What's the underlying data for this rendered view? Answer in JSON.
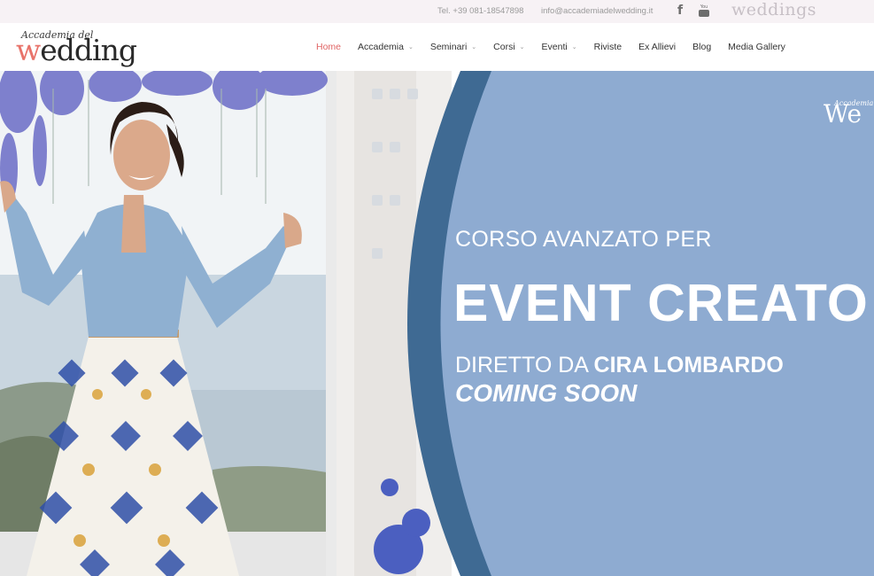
{
  "topbar": {
    "phone": "Tel. +39 081-18547898",
    "email": "info@accademiadelwedding.it",
    "facebook_icon": "facebook-icon",
    "youtube_icon": "youtube-icon",
    "youtube_text": "You",
    "partner_logo": "weddings"
  },
  "header": {
    "logo_small": "Accademia del",
    "logo_big_first": "w",
    "logo_big_rest": "edding",
    "nav": [
      {
        "label": "Home",
        "active": true,
        "dropdown": false
      },
      {
        "label": "Accademia",
        "active": false,
        "dropdown": true
      },
      {
        "label": "Seminari",
        "active": false,
        "dropdown": true
      },
      {
        "label": "Corsi",
        "active": false,
        "dropdown": true
      },
      {
        "label": "Eventi",
        "active": false,
        "dropdown": true
      },
      {
        "label": "Riviste",
        "active": false,
        "dropdown": false
      },
      {
        "label": "Ex Allievi",
        "active": false,
        "dropdown": false
      },
      {
        "label": "Blog",
        "active": false,
        "dropdown": false
      },
      {
        "label": "Media Gallery",
        "active": false,
        "dropdown": false
      }
    ]
  },
  "hero": {
    "line1": "CORSO AVANZATO PER",
    "line2": "EVENT CREATO",
    "line3_prefix": "DIRETTO DA ",
    "line3_name": "CIRA LOMBARDO",
    "line4": "COMING SOON",
    "mini_logo_small": "Accademia",
    "mini_logo_big": "We",
    "colors": {
      "panel": "#8eabd1",
      "arc": "#3f6a93",
      "accent": "#e06464"
    }
  }
}
